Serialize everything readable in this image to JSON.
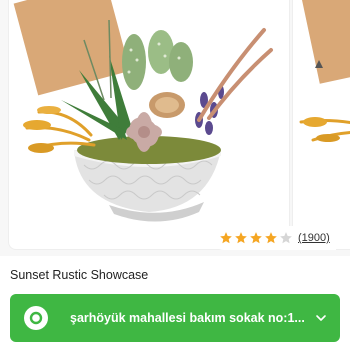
{
  "product": {
    "title": "Sunset Rustic Showcase",
    "rating": {
      "filled_stars": 4,
      "total_stars": 5,
      "count_label": "(1900)",
      "star_color": "#f5a623",
      "empty_star_color": "#d6d6d6"
    }
  },
  "delivery": {
    "address": "şarhöyük mahallesi bakım sokak no:1...",
    "background_color": "#3fb743"
  },
  "icons": {
    "location": "map-pin-icon",
    "expand": "chevron-down-icon"
  }
}
